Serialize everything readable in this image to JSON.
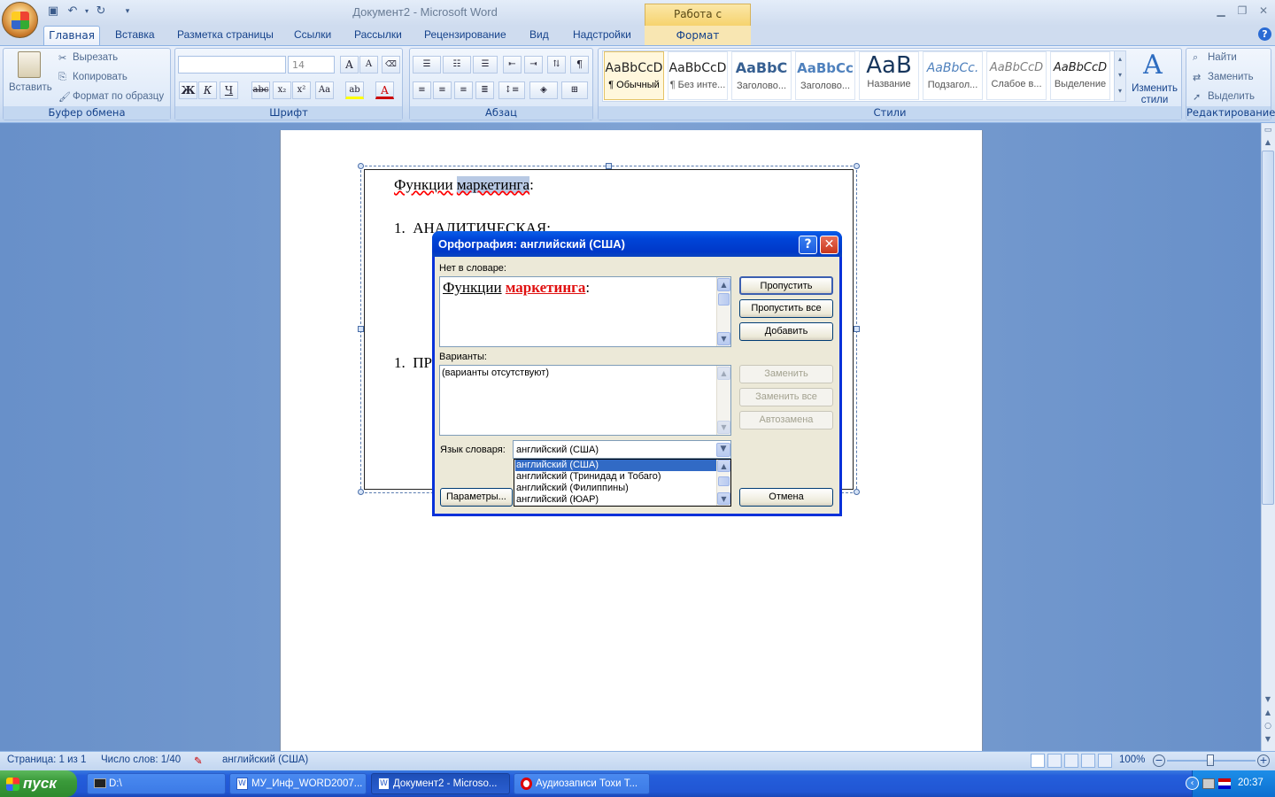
{
  "window": {
    "title": "Документ2 - Microsoft Word",
    "context_tab": "Работа с надписями"
  },
  "tabs": [
    "Главная",
    "Вставка",
    "Разметка страницы",
    "Ссылки",
    "Рассылки",
    "Рецензирование",
    "Вид",
    "Надстройки",
    "Формат"
  ],
  "ribbon": {
    "clipboard": {
      "paste": "Вставить",
      "cut": "Вырезать",
      "copy": "Копировать",
      "format_painter": "Формат по образцу",
      "label": "Буфер обмена"
    },
    "font": {
      "size": "14",
      "label": "Шрифт",
      "bold": "Ж",
      "italic": "К",
      "underline": "Ч",
      "strike": "abc",
      "sub": "x₂",
      "sup": "x²",
      "case": "Aa",
      "grow": "A",
      "shrink": "A",
      "color": "A"
    },
    "paragraph": {
      "label": "Абзац"
    },
    "styles": {
      "label": "Стили",
      "items": [
        {
          "sample": "AaBbCcD",
          "name": "¶ Обычный"
        },
        {
          "sample": "AaBbCcD",
          "name": "¶ Без инте..."
        },
        {
          "sample": "AaBbC",
          "name": "Заголово..."
        },
        {
          "sample": "AaBbCc",
          "name": "Заголово..."
        },
        {
          "sample": "AaB",
          "name": "Название"
        },
        {
          "sample": "AaBbCc.",
          "name": "Подзагол..."
        },
        {
          "sample": "AaBbCcD",
          "name": "Слабое в..."
        },
        {
          "sample": "AaBbCcD",
          "name": "Выделение"
        }
      ],
      "change_styles": "Изменить стили"
    },
    "editing": {
      "find": "Найти",
      "replace": "Заменить",
      "select": "Выделить",
      "label": "Редактирование"
    }
  },
  "document": {
    "heading_word1": "Функции",
    "heading_word2": "маркетинга",
    "heading_colon": ":",
    "item1": "1.  АНАЛИТИЧЕСКАЯ:",
    "item2": "1.  ПР"
  },
  "dialog": {
    "title": "Орфография: английский (США)",
    "not_in_dict_label": "Нет в словаре:",
    "context_word1": "Функции",
    "context_word2": "маркетинга",
    "context_colon": ":",
    "suggestions_label": "Варианты:",
    "suggestions_empty": "(варианты отсутствуют)",
    "lang_label": "Язык словаря:",
    "lang_value": "английский (США)",
    "lang_options": [
      "английский (США)",
      "английский (Тринидад и Тобаго)",
      "английский (Филиппины)",
      "английский (ЮАР)"
    ],
    "buttons": {
      "ignore": "Пропустить",
      "ignore_all": "Пропустить все",
      "add": "Добавить",
      "change": "Заменить",
      "change_all": "Заменить все",
      "autocorrect": "Автозамена",
      "options": "Параметры...",
      "cancel": "Отмена"
    }
  },
  "statusbar": {
    "page": "Страница: 1 из 1",
    "words": "Число слов: 1/40",
    "language": "английский (США)",
    "zoom": "100%"
  },
  "taskbar": {
    "start": "пуск",
    "tasks": [
      "D:\\",
      "МУ_Инф_WORD2007...",
      "Документ2 - Microso...",
      "Аудиозаписи Тохи Т..."
    ],
    "clock": "20:37"
  }
}
